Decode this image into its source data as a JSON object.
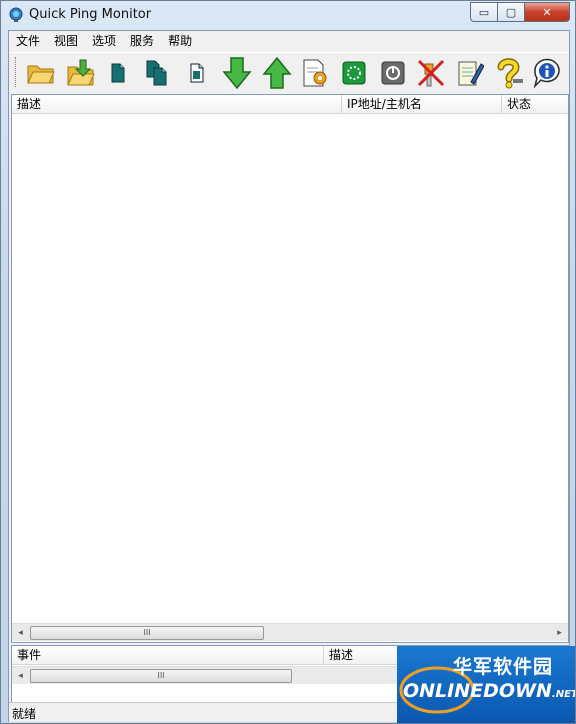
{
  "window": {
    "title": "Quick Ping Monitor",
    "controls": {
      "minimize": "▭",
      "maximize": "▢",
      "close": "✕"
    }
  },
  "menu": [
    "文件",
    "视图",
    "选项",
    "服务",
    "帮助"
  ],
  "toolbar": [
    {
      "name": "open-folder-icon"
    },
    {
      "name": "open-file-icon"
    },
    {
      "name": "new-host-icon"
    },
    {
      "name": "copy-host-icon"
    },
    {
      "name": "new-document-icon"
    },
    {
      "name": "move-down-icon"
    },
    {
      "name": "move-up-icon"
    },
    {
      "name": "properties-icon"
    },
    {
      "name": "start-service-icon"
    },
    {
      "name": "stop-service-icon"
    },
    {
      "name": "disconnect-icon"
    },
    {
      "name": "edit-notes-icon"
    },
    {
      "name": "help-icon"
    },
    {
      "name": "about-icon"
    }
  ],
  "host_list": {
    "columns": [
      "描述",
      "IP地址/主机名",
      "状态"
    ],
    "scroll_thumb": "III"
  },
  "event_list": {
    "columns": [
      "事件",
      "描述"
    ],
    "scroll_thumb": "III"
  },
  "status": {
    "text": "就绪"
  },
  "watermark": {
    "cn": "华军软件园",
    "en": "ONLINEDOWN",
    "suffix": ".NET"
  }
}
